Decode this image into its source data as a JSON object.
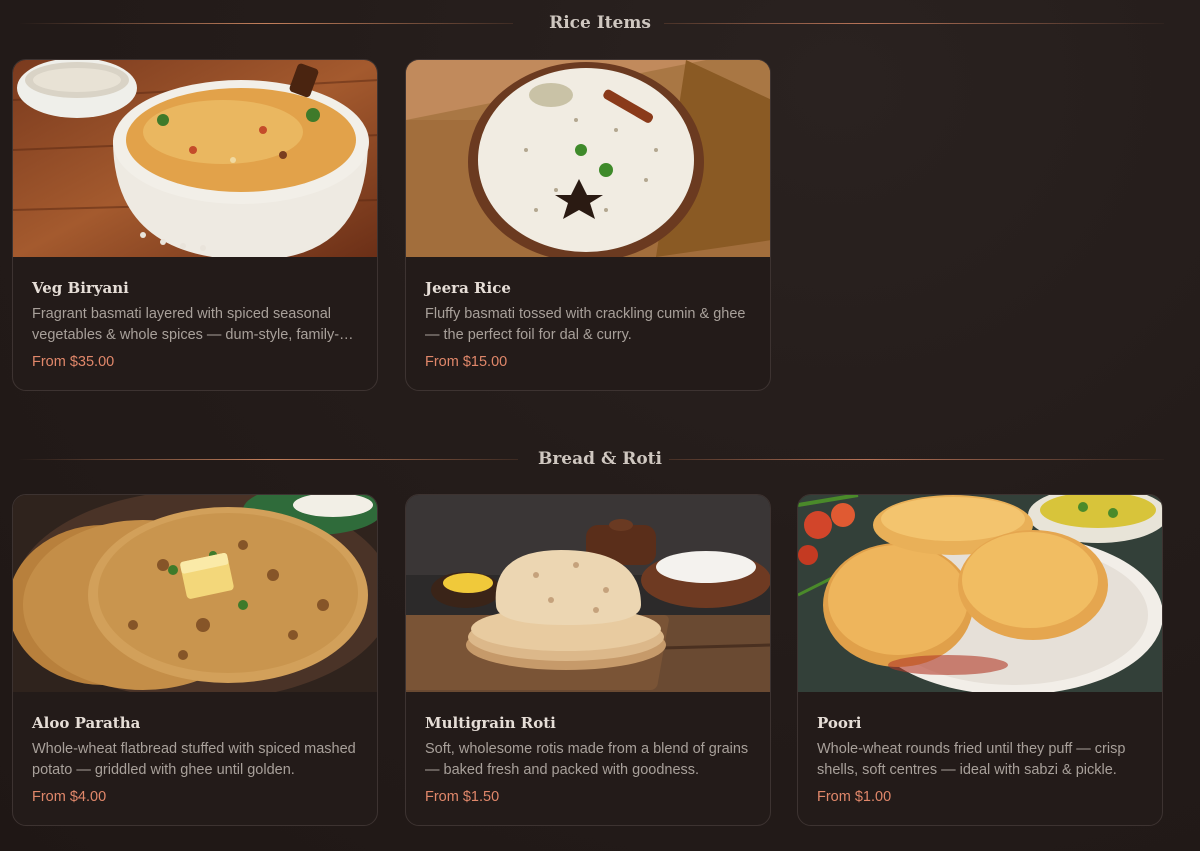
{
  "sections": [
    {
      "title": "Rice Items",
      "items": [
        {
          "name": "Veg Biryani",
          "description": "Fragrant basmati layered with spiced seasonal vegetables & whole spices — dum-style, family-style portions.",
          "price": "From $35.00",
          "image_icon": "biryani-bowl-photo"
        },
        {
          "name": "Jeera Rice",
          "description": "Fluffy basmati tossed with crackling cumin & ghee — the perfect foil for dal & curry.",
          "price": "From $15.00",
          "image_icon": "jeera-rice-bowl-photo"
        }
      ]
    },
    {
      "title": "Bread & Roti",
      "items": [
        {
          "name": "Aloo Paratha",
          "description": "Whole-wheat flatbread stuffed with spiced mashed potato — griddled with ghee until golden.",
          "price": "From $4.00",
          "image_icon": "paratha-photo"
        },
        {
          "name": "Multigrain Roti",
          "description": "Soft, wholesome rotis made from a blend of grains — baked fresh and packed with goodness.",
          "price": "From $1.50",
          "image_icon": "roti-stack-photo"
        },
        {
          "name": "Poori",
          "description": "Whole-wheat rounds fried until they puff — crisp shells, soft centres — ideal with sabzi & pickle.",
          "price": "From $1.00",
          "image_icon": "poori-plate-photo"
        }
      ]
    }
  ],
  "colors": {
    "accent": "#e0876a",
    "background": "#241c1a",
    "card": "#231b19"
  }
}
